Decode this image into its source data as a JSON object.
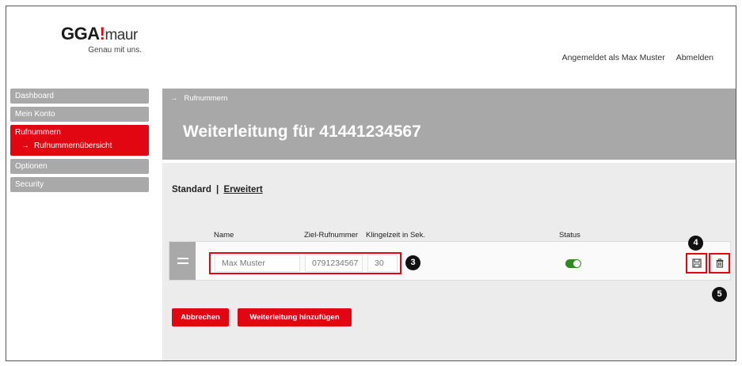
{
  "header": {
    "logo_main": "GGA",
    "logo_excl": "!",
    "logo_sub": "maur",
    "logo_tagline": "Genau mit uns.",
    "logged_in_text": "Angemeldet als Max Muster",
    "logout_label": "Abmelden"
  },
  "sidebar": {
    "items": [
      {
        "label": "Dashboard"
      },
      {
        "label": "Mein Konto"
      },
      {
        "label": "Rufnummern",
        "sub_label": "Rufnummernübersicht"
      },
      {
        "label": "Optionen"
      },
      {
        "label": "Security"
      }
    ]
  },
  "breadcrumb": {
    "arrow": "→",
    "label": "Rufnummern"
  },
  "page_title": "Weiterleitung für 41441234567",
  "tabs": {
    "standard": "Standard",
    "separator": "|",
    "erweitert": "Erweitert"
  },
  "columns": {
    "name": "Name",
    "target": "Ziel-Rufnummer",
    "ring_time": "Klingelzeit in Sek.",
    "status": "Status"
  },
  "row": {
    "name_value": "Max Muster",
    "target_value": "0791234567",
    "ring_value": "30",
    "status_on": true
  },
  "annotations": {
    "row_fields": "3",
    "save": "4",
    "delete": "5"
  },
  "buttons": {
    "cancel": "Abbrechen",
    "add": "Weiterleitung hinzufügen"
  },
  "icons": {
    "save": "floppy-disk-icon",
    "delete": "trash-icon",
    "drag": "drag-handle-icon",
    "arrow": "arrow-right-icon"
  },
  "colors": {
    "accent": "#e20613",
    "gray": "#a9a9a9",
    "toggle": "#2e8b1f"
  }
}
